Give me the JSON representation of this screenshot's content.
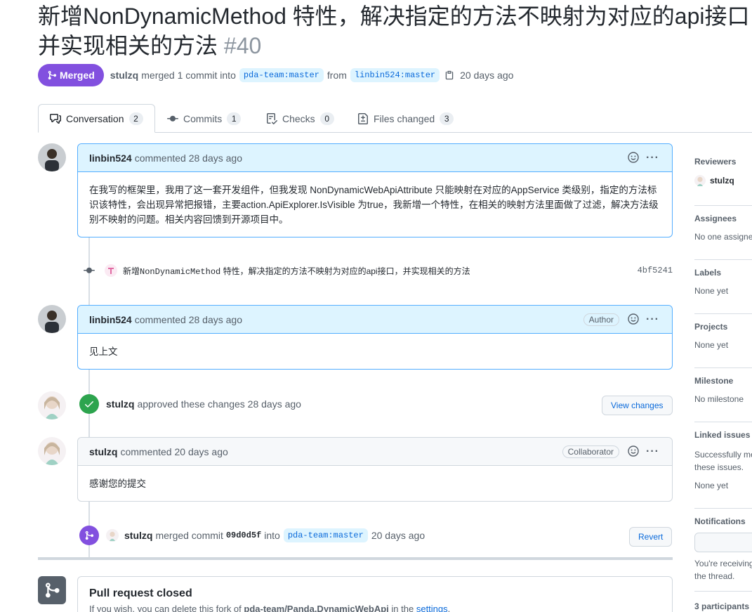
{
  "header": {
    "title_line1": "新增NonDynamicMethod 特性，解决指定的方法不映射为对应的api接口",
    "title_line2": "并实现相关的方法",
    "number": "#40",
    "state": "Merged",
    "author": "stulzq",
    "merge_text": "merged 1 commit into",
    "base_branch": "pda-team:master",
    "from_text": "from",
    "head_branch": "linbin524:master",
    "time": "20 days ago"
  },
  "tabs": [
    {
      "label": "Conversation",
      "count": "2"
    },
    {
      "label": "Commits",
      "count": "1"
    },
    {
      "label": "Checks",
      "count": "0"
    },
    {
      "label": "Files changed",
      "count": "3"
    }
  ],
  "comments": [
    {
      "author": "linbin524",
      "meta": "commented 28 days ago",
      "body": "在我写的框架里，我用了这一套开发组件，但我发现 NonDynamicWebApiAttribute 只能映射在对应的AppService 类级别，指定的方法标识该特性，会出现异常把报错，主要action.ApiExplorer.IsVisible 为true，我新增一个特性，在相关的映射方法里面做了过滤，解决方法级别不映射的问题。相关内容回馈到开源项目中。"
    },
    {
      "author": "linbin524",
      "meta": "commented 28 days ago",
      "role": "Author",
      "body": "见上文"
    },
    {
      "author": "stulzq",
      "meta": "commented 20 days ago",
      "role": "Collaborator",
      "body": "感谢您的提交"
    }
  ],
  "commit": {
    "message_prefix": "新增",
    "message_code": "NonDynamicMethod",
    "message_rest": " 特性，解决指定的方法不映射为对应的api接口，并实现相关的方法",
    "sha": "4bf5241"
  },
  "review": {
    "author": "stulzq",
    "text": "approved these changes 28 days ago",
    "button": "View changes"
  },
  "merge_event": {
    "author": "stulzq",
    "text1": "merged commit",
    "sha": "09d0d5f",
    "text2": "into",
    "branch": "pda-team:master",
    "time": "20 days ago",
    "button": "Revert"
  },
  "closed_box": {
    "title": "Pull request closed",
    "sub_prefix": "If you wish, you can delete this fork of",
    "sub_repo": "pda-team/Panda.DynamicWebApi",
    "sub_mid": "in the",
    "sub_link": "settings",
    "sub_suffix": "."
  },
  "sidebar": {
    "reviewers_h": "Reviewers",
    "reviewer": "stulzq",
    "assignees_h": "Assignees",
    "assignees_v": "No one assigne",
    "labels_h": "Labels",
    "labels_v": "None yet",
    "projects_h": "Projects",
    "projects_v": "None yet",
    "milestone_h": "Milestone",
    "milestone_v": "No milestone",
    "linked_h": "Linked issues",
    "linked_v1": "Successfully me",
    "linked_v2": "these issues.",
    "linked_v3": "None yet",
    "notif_h": "Notifications",
    "notif_v1": "You're receiving",
    "notif_v2": "the thread.",
    "participants_h": "3 participants"
  },
  "colors": {
    "merged": "#8250df",
    "approved": "#2da44e",
    "link": "#0969da",
    "comment_border": "#54aeff",
    "comment_header": "#ddf4ff"
  }
}
